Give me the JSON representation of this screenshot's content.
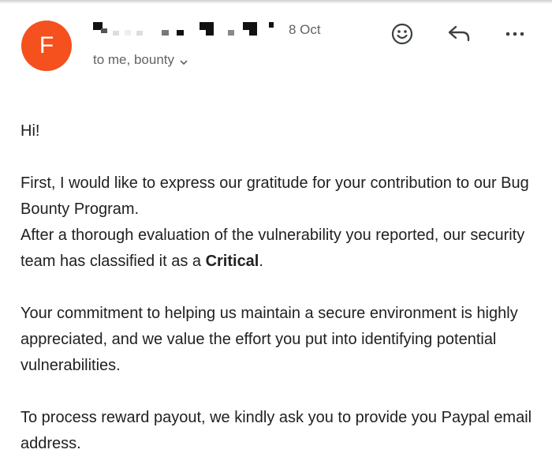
{
  "window": {
    "accent_color": "#f4511e"
  },
  "header": {
    "avatar_letter": "F",
    "sender_redacted": true,
    "date": "8 Oct",
    "recipients": "to me, bounty",
    "icons": {
      "emoji": "emoji-reaction-icon",
      "reply": "reply-icon",
      "more": "more-options-icon",
      "chevron": "chevron-down-icon"
    }
  },
  "message": {
    "greeting": "Hi!",
    "line1": "First, I would like to express our gratitude for your contribution to our Bug Bounty Program.",
    "line2_before": "After a thorough evaluation of the vulnerability you reported, our security team has classified it as a ",
    "line2_bold": "Critical",
    "line2_after": ".",
    "line3": "Your commitment to helping us maintain a secure environment is highly appreciated, and we value the effort you put into identifying potential vulnerabilities.",
    "line4": "To process reward payout, we kindly ask you to provide you Paypal email address."
  }
}
